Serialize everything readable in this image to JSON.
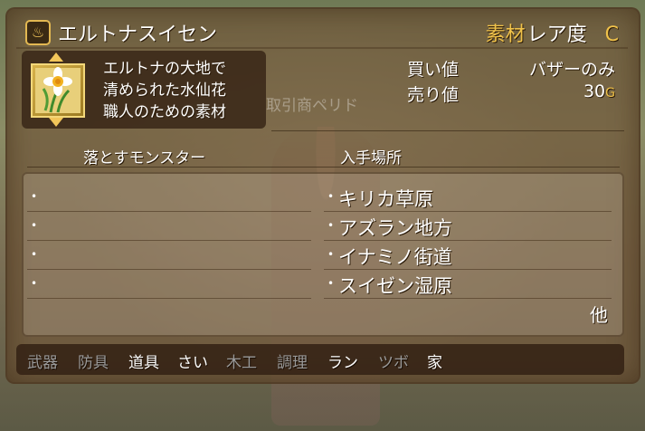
{
  "item": {
    "name": "エルトナスイセン",
    "description": "エルトナの大地で\n清められた水仙花\n職人のための素材"
  },
  "rarity": {
    "label_material": "素材",
    "label_rarity": "レア度",
    "grade": "C"
  },
  "prices": {
    "buy_label": "買い値",
    "buy_value": "バザーのみ",
    "sell_label": "売り値",
    "sell_value": "30",
    "sell_unit": "G"
  },
  "background_text": "取引商ペリド",
  "sections": {
    "monsters_header": "落とすモンスター",
    "locations_header": "入手場所"
  },
  "monsters": [
    "",
    "",
    "",
    ""
  ],
  "locations": [
    "キリカ草原",
    "アズラン地方",
    "イナミノ街道",
    "スイゼン湿原"
  ],
  "more_label": "他",
  "categories": [
    {
      "label": "武器",
      "active": false
    },
    {
      "label": "防具",
      "active": false
    },
    {
      "label": "道具",
      "active": true
    },
    {
      "label": "さい",
      "active": true
    },
    {
      "label": "木工",
      "active": false
    },
    {
      "label": "調理",
      "active": false
    },
    {
      "label": "ラン",
      "active": true
    },
    {
      "label": "ツボ",
      "active": false
    },
    {
      "label": "家",
      "active": true
    }
  ],
  "colors": {
    "accent_gold": "#f0c24a",
    "inactive_tab": "#9a9a9a",
    "active_tab": "#ffffff"
  }
}
